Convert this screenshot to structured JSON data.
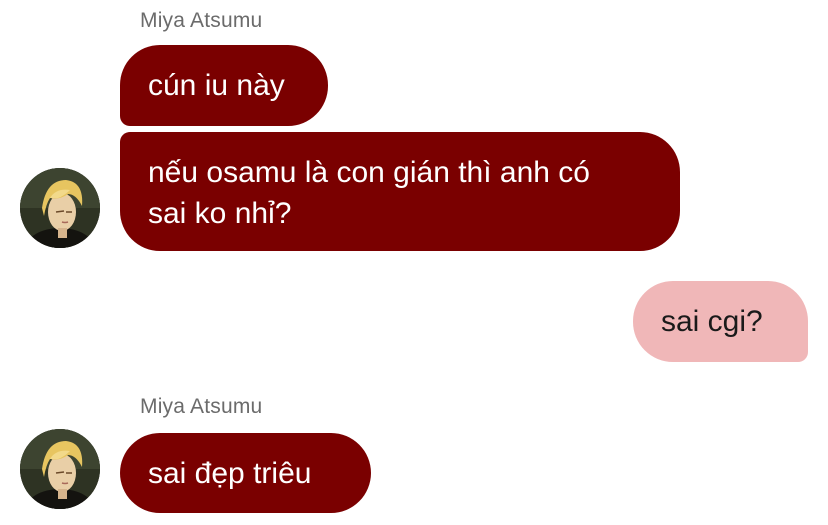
{
  "messages": [
    {
      "sender": "Miya Atsumu",
      "bubbles": [
        "cún iu này",
        "nếu osamu là con gián thì anh có\nsai ko nhỉ?"
      ]
    },
    {
      "sender": "me",
      "bubbles": [
        "sai cgi?"
      ]
    },
    {
      "sender": "Miya Atsumu",
      "bubbles": [
        "sai đẹp triêu"
      ]
    }
  ],
  "group1": {
    "sender_name": "Miya Atsumu",
    "bubble1": "cún iu này",
    "bubble2_line1": "nếu osamu là con gián thì anh có",
    "bubble2_line2": "sai ko nhỉ?"
  },
  "outgoing": {
    "bubble1": "sai cgi?"
  },
  "group2": {
    "sender_name": "Miya Atsumu",
    "bubble1": "sai đẹp triêu"
  },
  "colors": {
    "incoming_bubble": "#7a0000",
    "outgoing_bubble": "#f0b7b8",
    "sender_name": "#6b6b6b"
  },
  "icons": {
    "avatar": "avatar-blond-character"
  }
}
